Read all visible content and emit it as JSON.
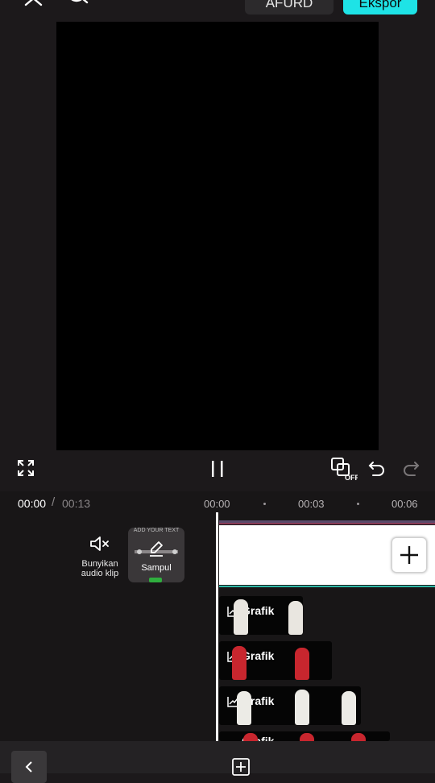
{
  "header": {
    "resolution_label": "AFURD",
    "export_label": "Ekspor",
    "accent": "#1ee3e6"
  },
  "playback": {
    "current_time": "00:00",
    "separator": "/",
    "total_time": "00:13"
  },
  "ruler": {
    "ticks": [
      "00:00",
      "00:03",
      "00:06"
    ]
  },
  "track_tools": {
    "mute_label_line1": "Bunyikan",
    "mute_label_line2": "audio klip",
    "cover_label": "Sampul",
    "cover_thumb_text": "ADD YOUR TEXT"
  },
  "overlays": [
    {
      "label": "Grafik",
      "kit": "white"
    },
    {
      "label": "Grafik",
      "kit": "red"
    },
    {
      "label": "Grafik",
      "kit": "white"
    },
    {
      "label": "Grafik",
      "kit": "red"
    }
  ],
  "icons": [
    "close-icon",
    "search-icon",
    "fullscreen-icon",
    "pause-icon",
    "keyframe-off-icon",
    "undo-icon",
    "redo-icon",
    "mute-icon",
    "edit-icon",
    "add-icon",
    "chart-icon",
    "back-icon",
    "add-box-icon"
  ]
}
